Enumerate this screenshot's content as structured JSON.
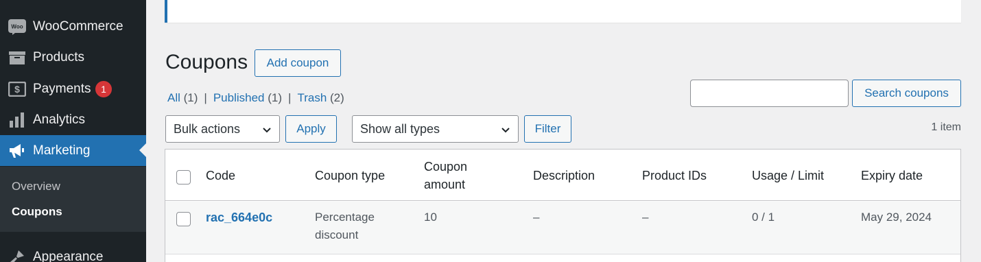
{
  "sidebar": {
    "items": [
      {
        "label": "WooCommerce",
        "icon": "woo-icon"
      },
      {
        "label": "Products",
        "icon": "archive-icon"
      },
      {
        "label": "Payments",
        "icon": "dollar-icon",
        "badge": "1"
      },
      {
        "label": "Analytics",
        "icon": "bar-chart-icon"
      },
      {
        "label": "Marketing",
        "icon": "megaphone-icon",
        "active": true
      },
      {
        "label": "Appearance",
        "icon": "paintbrush-icon"
      }
    ],
    "woo_icon_text": "Woo",
    "submenu": [
      {
        "label": "Overview"
      },
      {
        "label": "Coupons",
        "current": true
      }
    ]
  },
  "page": {
    "title": "Coupons",
    "add_button": "Add coupon"
  },
  "filters": {
    "all": {
      "label": "All",
      "count": "(1)"
    },
    "published": {
      "label": "Published",
      "count": "(1)"
    },
    "trash": {
      "label": "Trash",
      "count": "(2)"
    },
    "separator": "|"
  },
  "search": {
    "value": "",
    "button": "Search coupons"
  },
  "toolbar": {
    "bulk_actions": "Bulk actions",
    "apply": "Apply",
    "type_select": "Show all types",
    "filter": "Filter",
    "items_count": "1 item"
  },
  "table": {
    "columns": [
      "Code",
      "Coupon type",
      "Coupon amount",
      "Description",
      "Product IDs",
      "Usage / Limit",
      "Expiry date"
    ],
    "column_amount_lines": [
      "Coupon",
      "amount"
    ],
    "rows": [
      {
        "code": "rac_664e0c",
        "type_lines": [
          "Percentage",
          "discount"
        ],
        "amount": "10",
        "description": "–",
        "product_ids": "–",
        "usage": "0 / 1",
        "expiry": "May 29, 2024"
      }
    ]
  },
  "colors": {
    "sidebar_bg": "#1d2327",
    "accent": "#2271b1",
    "badge": "#d63638"
  }
}
